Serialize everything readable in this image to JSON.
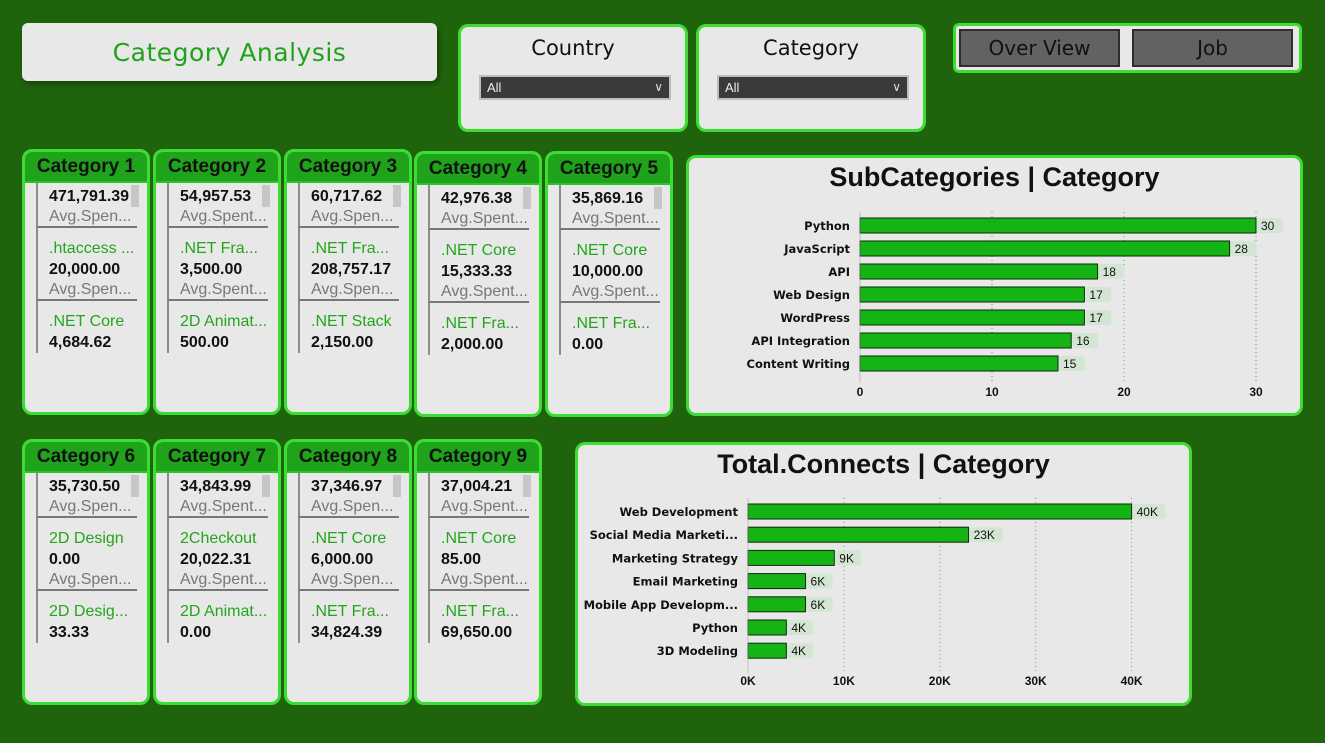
{
  "header": {
    "title": "Category Analysis"
  },
  "filters": [
    {
      "title": "Country",
      "value": "All"
    },
    {
      "title": "Category",
      "value": "All"
    }
  ],
  "nav": {
    "overview": "Over View",
    "job": "Job"
  },
  "cards": [
    {
      "title": "Category 1",
      "rows": [
        {
          "name": "",
          "value": "471,791.39",
          "label": "Avg.Spen..."
        },
        {
          "name": ".htaccess ...",
          "value": "20,000.00",
          "label": "Avg.Spen..."
        },
        {
          "name": ".NET Core",
          "value": "4,684.62",
          "label": ""
        }
      ]
    },
    {
      "title": "Category 2",
      "rows": [
        {
          "name": "",
          "value": "54,957.53",
          "label": "Avg.Spent..."
        },
        {
          "name": ".NET Fra...",
          "value": "3,500.00",
          "label": "Avg.Spent..."
        },
        {
          "name": "2D Animat...",
          "value": "500.00",
          "label": ""
        }
      ]
    },
    {
      "title": "Category 3",
      "rows": [
        {
          "name": "",
          "value": "60,717.62",
          "label": "Avg.Spen..."
        },
        {
          "name": ".NET Fra...",
          "value": "208,757.17",
          "label": "Avg.Spen..."
        },
        {
          "name": ".NET Stack",
          "value": "2,150.00",
          "label": ""
        }
      ]
    },
    {
      "title": "Category 4",
      "rows": [
        {
          "name": "",
          "value": "42,976.38",
          "label": "Avg.Spent..."
        },
        {
          "name": ".NET Core",
          "value": "15,333.33",
          "label": "Avg.Spent..."
        },
        {
          "name": ".NET Fra...",
          "value": "2,000.00",
          "label": ""
        }
      ]
    },
    {
      "title": "Category 5",
      "rows": [
        {
          "name": "",
          "value": "35,869.16",
          "label": "Avg.Spent..."
        },
        {
          "name": ".NET Core",
          "value": "10,000.00",
          "label": "Avg.Spent..."
        },
        {
          "name": ".NET Fra...",
          "value": "0.00",
          "label": ""
        }
      ]
    },
    {
      "title": "Category 6",
      "rows": [
        {
          "name": "",
          "value": "35,730.50",
          "label": "Avg.Spen..."
        },
        {
          "name": "2D Design",
          "value": "0.00",
          "label": "Avg.Spen..."
        },
        {
          "name": "2D Desig...",
          "value": "33.33",
          "label": ""
        }
      ]
    },
    {
      "title": "Category 7",
      "rows": [
        {
          "name": "",
          "value": "34,843.99",
          "label": "Avg.Spent..."
        },
        {
          "name": "2Checkout",
          "value": "20,022.31",
          "label": "Avg.Spent..."
        },
        {
          "name": "2D Animat...",
          "value": "0.00",
          "label": ""
        }
      ]
    },
    {
      "title": "Category 8",
      "rows": [
        {
          "name": "",
          "value": "37,346.97",
          "label": "Avg.Spen..."
        },
        {
          "name": ".NET Core",
          "value": "6,000.00",
          "label": "Avg.Spen..."
        },
        {
          "name": ".NET Fra...",
          "value": "34,824.39",
          "label": ""
        }
      ]
    },
    {
      "title": "Category 9",
      "rows": [
        {
          "name": "",
          "value": "37,004.21",
          "label": "Avg.Spent..."
        },
        {
          "name": ".NET Core",
          "value": "85.00",
          "label": "Avg.Spent..."
        },
        {
          "name": ".NET Fra...",
          "value": "69,650.00",
          "label": ""
        }
      ]
    }
  ],
  "colors": {
    "bar": "#14b414",
    "bar_stroke": "#0a2a0a",
    "label_bg": "#d3e6d3"
  },
  "chart_data": [
    {
      "type": "bar",
      "orientation": "horizontal",
      "title": "SubCategories | Category",
      "categories": [
        "Python",
        "JavaScript",
        "API",
        "Web Design",
        "WordPress",
        "API Integration",
        "Content Writing"
      ],
      "values": [
        30,
        28,
        18,
        17,
        17,
        16,
        15
      ],
      "data_labels": [
        "30",
        "28",
        "18",
        "17",
        "17",
        "16",
        "15"
      ],
      "xticks": [
        "0",
        "10",
        "20",
        "30"
      ],
      "xlim": [
        0,
        32
      ],
      "grid": "vertical dotted"
    },
    {
      "type": "bar",
      "orientation": "horizontal",
      "title": "Total.Connects | Category",
      "categories": [
        "Web Development",
        "Social Media Marketi...",
        "Marketing Strategy",
        "Email Marketing",
        "Mobile App Developm...",
        "Python",
        "3D Modeling"
      ],
      "values": [
        40000,
        23000,
        9000,
        6000,
        6000,
        4000,
        4000
      ],
      "data_labels": [
        "40K",
        "23K",
        "9K",
        "6K",
        "6K",
        "4K",
        "4K"
      ],
      "xticks": [
        "0K",
        "10K",
        "20K",
        "30K",
        "40K"
      ],
      "xlim": [
        0,
        42000
      ],
      "grid": "vertical dotted"
    }
  ]
}
